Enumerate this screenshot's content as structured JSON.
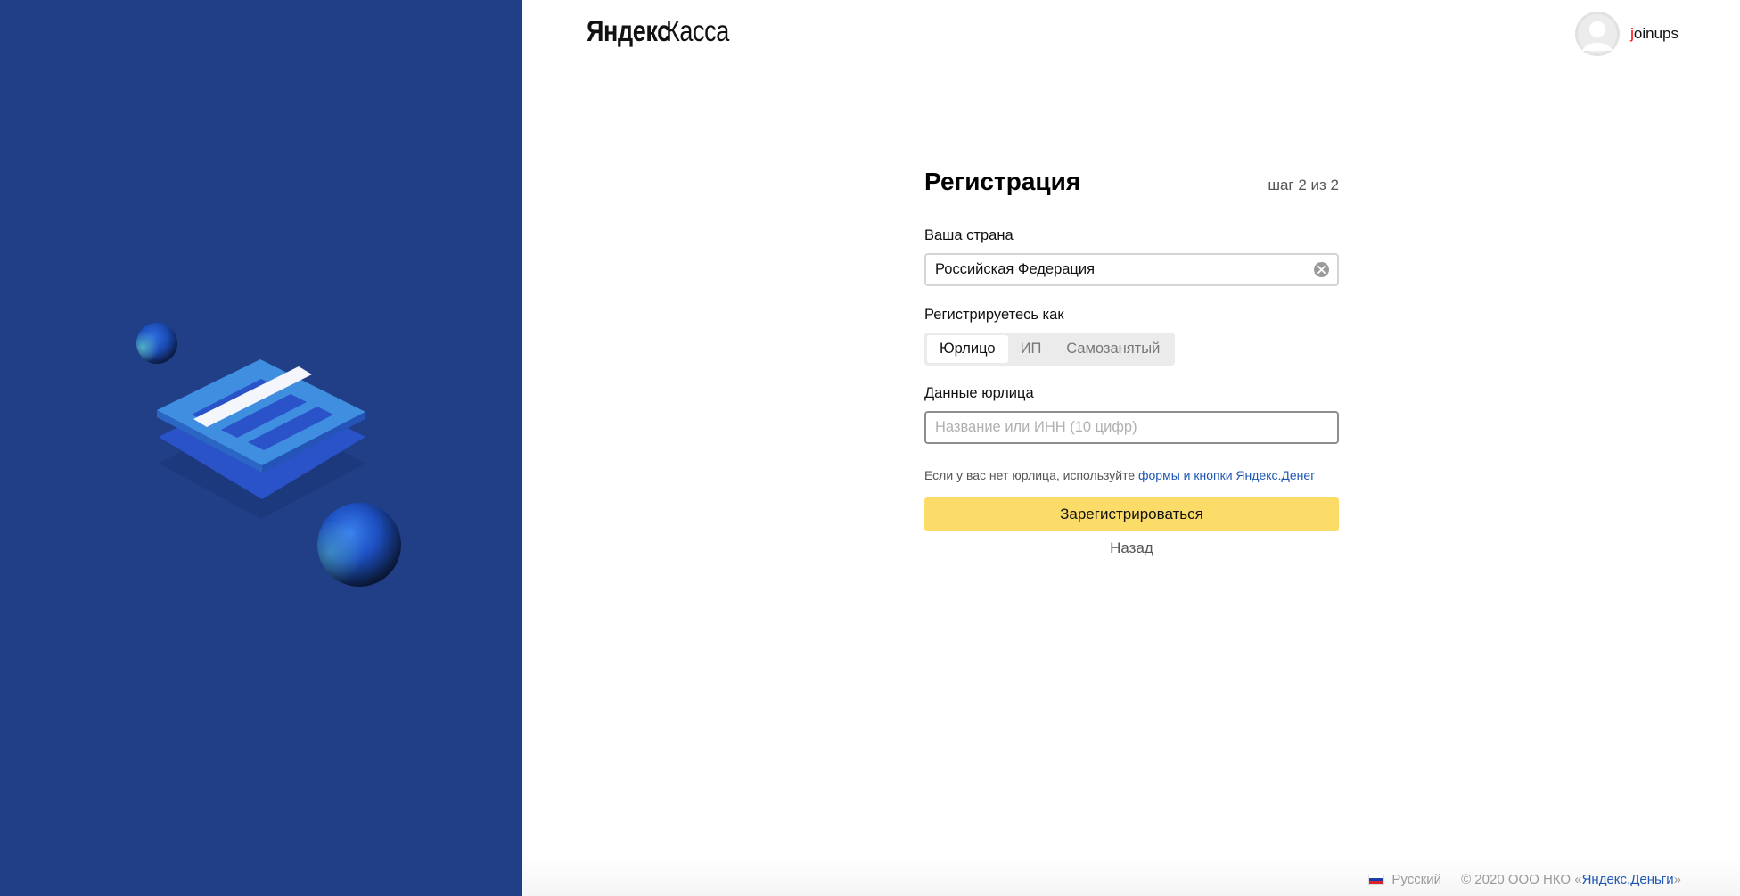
{
  "header": {
    "logo_part1": "Яндекс",
    "logo_part2": "Касса",
    "user_first_letter": "j",
    "user_rest": "oinups"
  },
  "form": {
    "title": "Регистрация",
    "step": "шаг 2 из 2",
    "country_label": "Ваша страна",
    "country_value": "Российская Федерация",
    "register_as_label": "Регистрируетесь как",
    "register_as_options": [
      "Юрлицо",
      "ИП",
      "Самозанятый"
    ],
    "register_as_selected": "Юрлицо",
    "entity_label": "Данные юрлица",
    "entity_placeholder": "Название или ИНН (10 цифр)",
    "hint_text": "Если у вас нет юрлица, используйте ",
    "hint_link": "формы и кнопки Яндекс.Денег",
    "submit_label": "Зарегистрироваться",
    "back_label": "Назад"
  },
  "footer": {
    "language": "Русский",
    "copyright_prefix": "© 2020  ООО НКО «",
    "copyright_link": "Яндекс.Деньги",
    "copyright_suffix": "»"
  },
  "colors": {
    "left_panel_bg": "#213f86",
    "submit_bg": "#fbdc69",
    "link": "#1e57b6"
  },
  "icons": {
    "clear": "clear-circle-icon",
    "avatar": "user-avatar-icon",
    "flag": "russian-flag-icon"
  }
}
